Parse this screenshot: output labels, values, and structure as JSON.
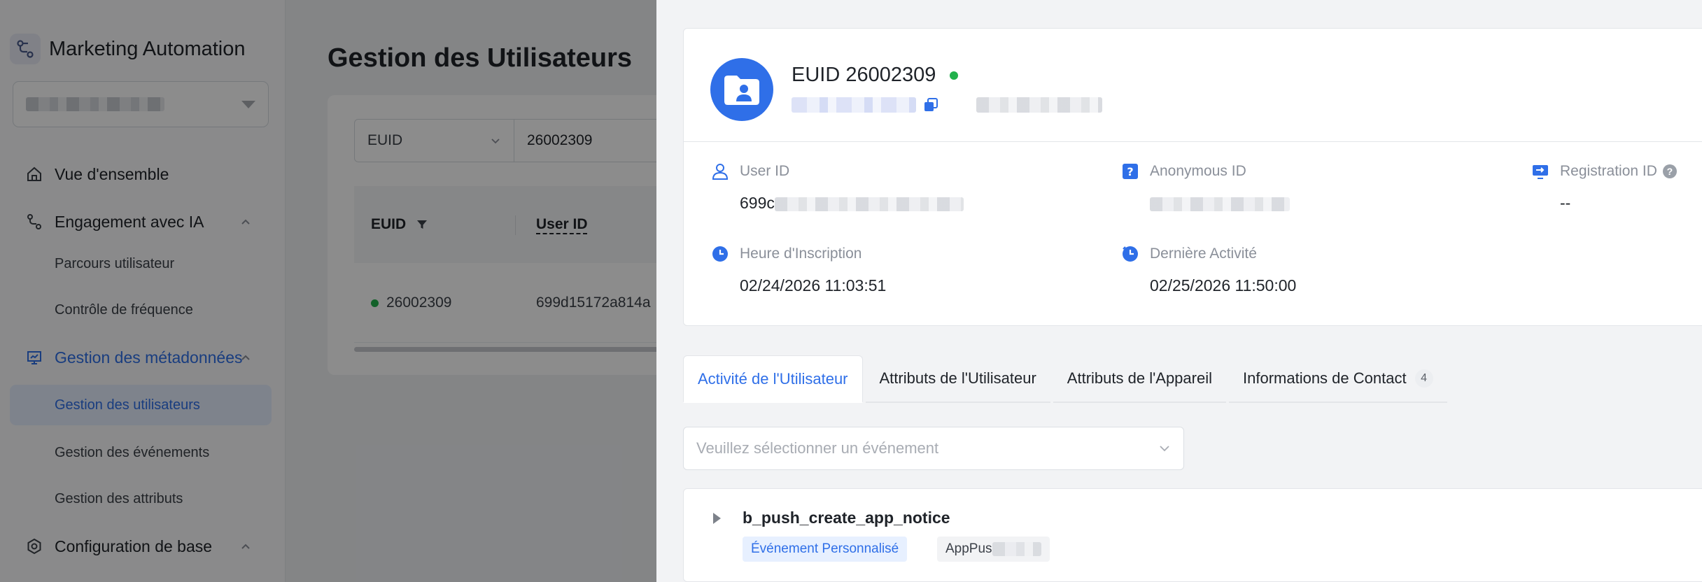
{
  "app": {
    "title": "Marketing Automation"
  },
  "sidebar": {
    "project_select": "",
    "items": [
      {
        "label": "Vue d'ensemble"
      },
      {
        "label": "Engagement avec IA"
      },
      {
        "label": "Parcours utilisateur"
      },
      {
        "label": "Contrôle de fréquence"
      },
      {
        "label": "Gestion des métadonnées"
      },
      {
        "label": "Gestion des utilisateurs"
      },
      {
        "label": "Gestion des événements"
      },
      {
        "label": "Gestion des attributs"
      },
      {
        "label": "Configuration de base"
      }
    ]
  },
  "main": {
    "title": "Gestion des Utilisateurs",
    "filter": {
      "field": "EUID",
      "value": "26002309"
    },
    "table": {
      "columns": [
        "EUID",
        "User ID"
      ],
      "rows": [
        {
          "euid": "26002309",
          "user_id": "699d15172a814a"
        }
      ]
    }
  },
  "drawer": {
    "euid_title": "EUID 26002309",
    "fields": {
      "user_id": {
        "label": "User ID",
        "value": "699c"
      },
      "anonymous_id": {
        "label": "Anonymous ID",
        "value": ""
      },
      "registration_id": {
        "label": "Registration ID",
        "value": "--"
      },
      "signup_time": {
        "label": "Heure d'Inscription",
        "value": "02/24/2026 11:03:51"
      },
      "last_activity": {
        "label": "Dernière Activité",
        "value": "02/25/2026 11:50:00"
      }
    },
    "tabs": [
      {
        "label": "Activité de l'Utilisateur"
      },
      {
        "label": "Attributs de l'Utilisateur"
      },
      {
        "label": "Attributs de l'Appareil"
      },
      {
        "label": "Informations de Contact",
        "badge": "4"
      }
    ],
    "event_select": {
      "placeholder": "Veuillez sélectionner un événement"
    },
    "events": [
      {
        "name": "b_push_create_app_notice",
        "tags": [
          "Événement Personnalisé",
          "AppPus"
        ]
      }
    ]
  },
  "colors": {
    "accent": "#2f6fe8",
    "online": "#22b14c",
    "overlay": "rgba(0,0,0,0.45)"
  }
}
